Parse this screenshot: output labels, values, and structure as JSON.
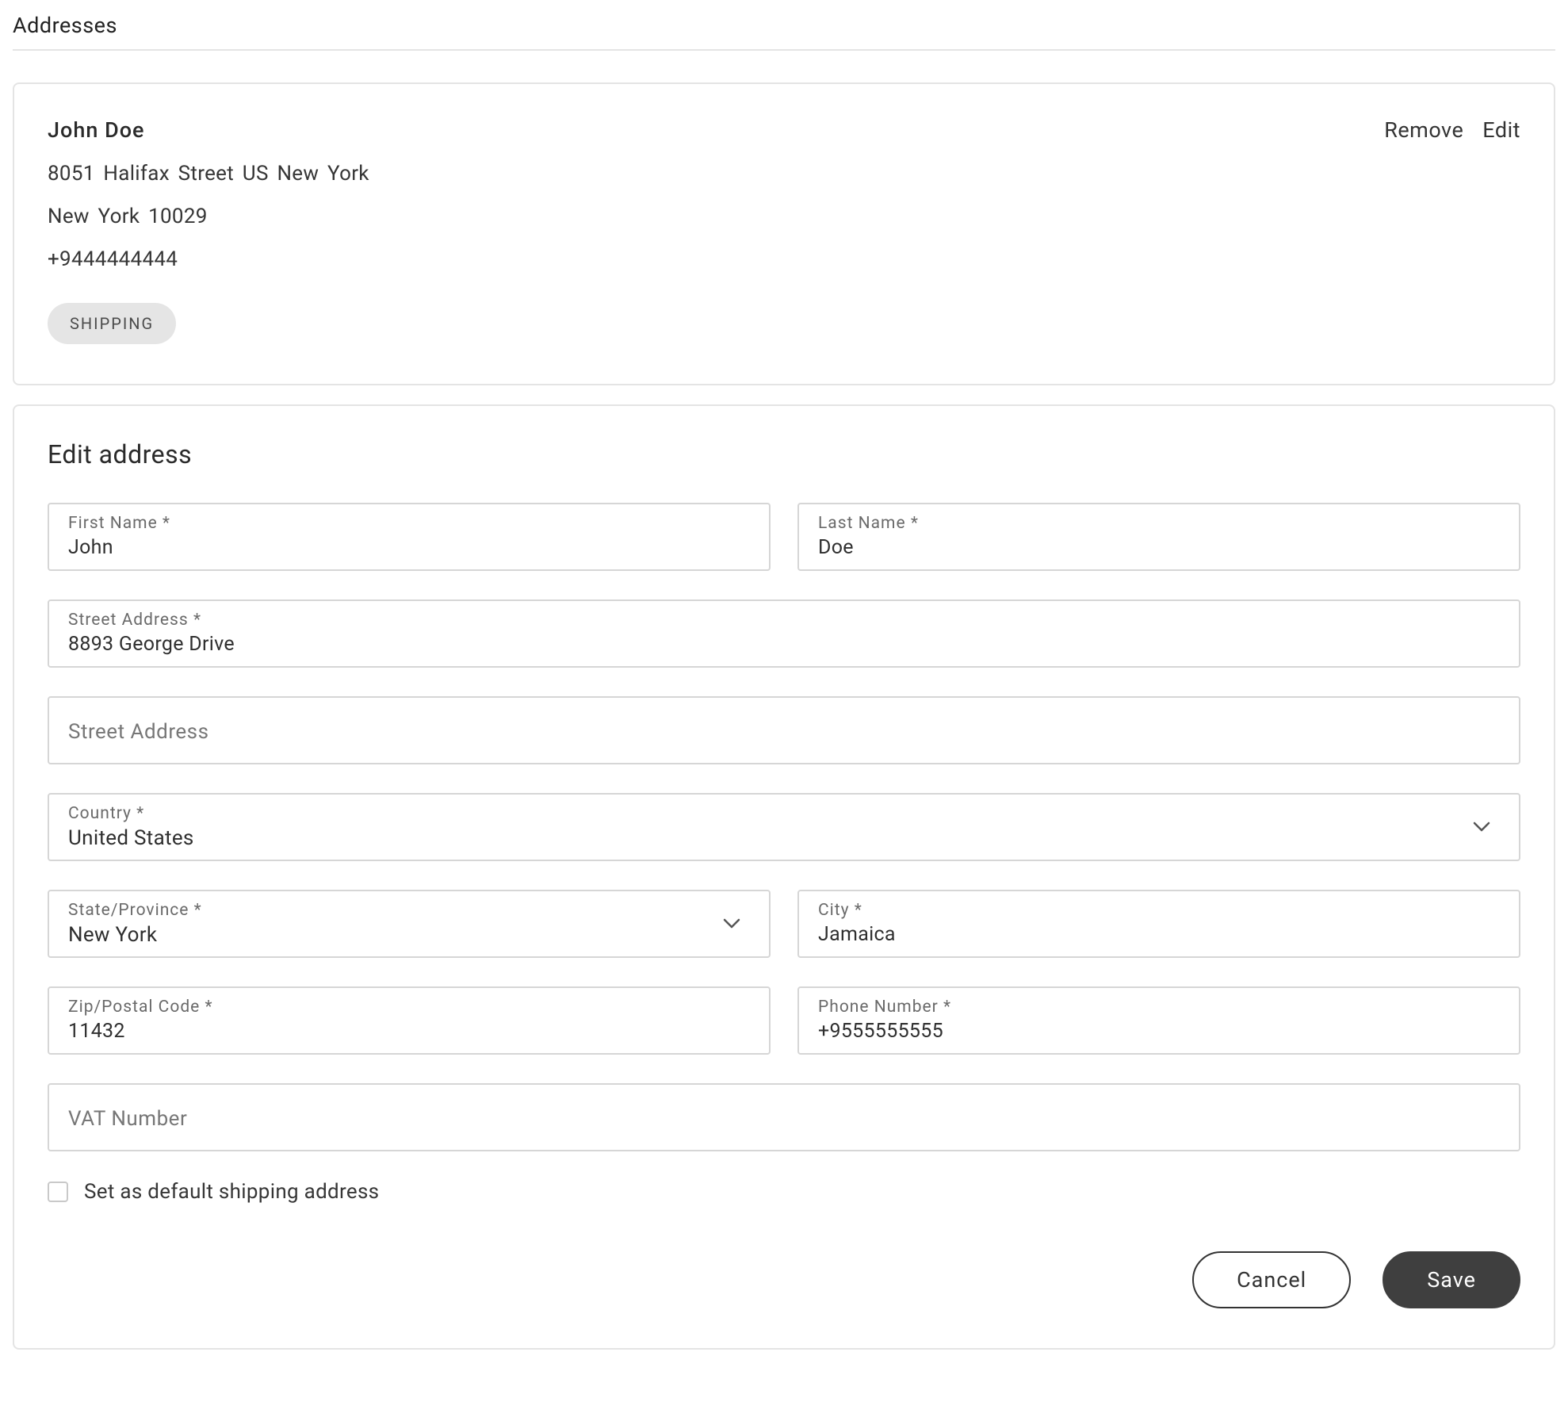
{
  "page": {
    "title": "Addresses"
  },
  "address_card": {
    "name": "John  Doe",
    "line1": "8051 Halifax Street  US  New York",
    "line2": "New York  10029",
    "phone": "+9444444444",
    "badge": "SHIPPING",
    "actions": {
      "remove": "Remove",
      "edit": "Edit"
    }
  },
  "edit_form": {
    "title": "Edit address",
    "fields": {
      "first_name": {
        "label": "First Name *",
        "value": "John"
      },
      "last_name": {
        "label": "Last Name *",
        "value": "Doe"
      },
      "street1": {
        "label": "Street Address *",
        "value": "8893 George Drive"
      },
      "street2": {
        "placeholder": "Street Address",
        "value": ""
      },
      "country": {
        "label": "Country *",
        "value": "United States"
      },
      "state": {
        "label": "State/Province *",
        "value": "New York"
      },
      "city": {
        "label": "City *",
        "value": "Jamaica"
      },
      "zip": {
        "label": "Zip/Postal Code *",
        "value": "11432"
      },
      "phone": {
        "label": "Phone Number *",
        "value": "+9555555555"
      },
      "vat": {
        "placeholder": "VAT Number",
        "value": ""
      }
    },
    "checkbox_label": "Set as default shipping address",
    "buttons": {
      "cancel": "Cancel",
      "save": "Save"
    }
  }
}
